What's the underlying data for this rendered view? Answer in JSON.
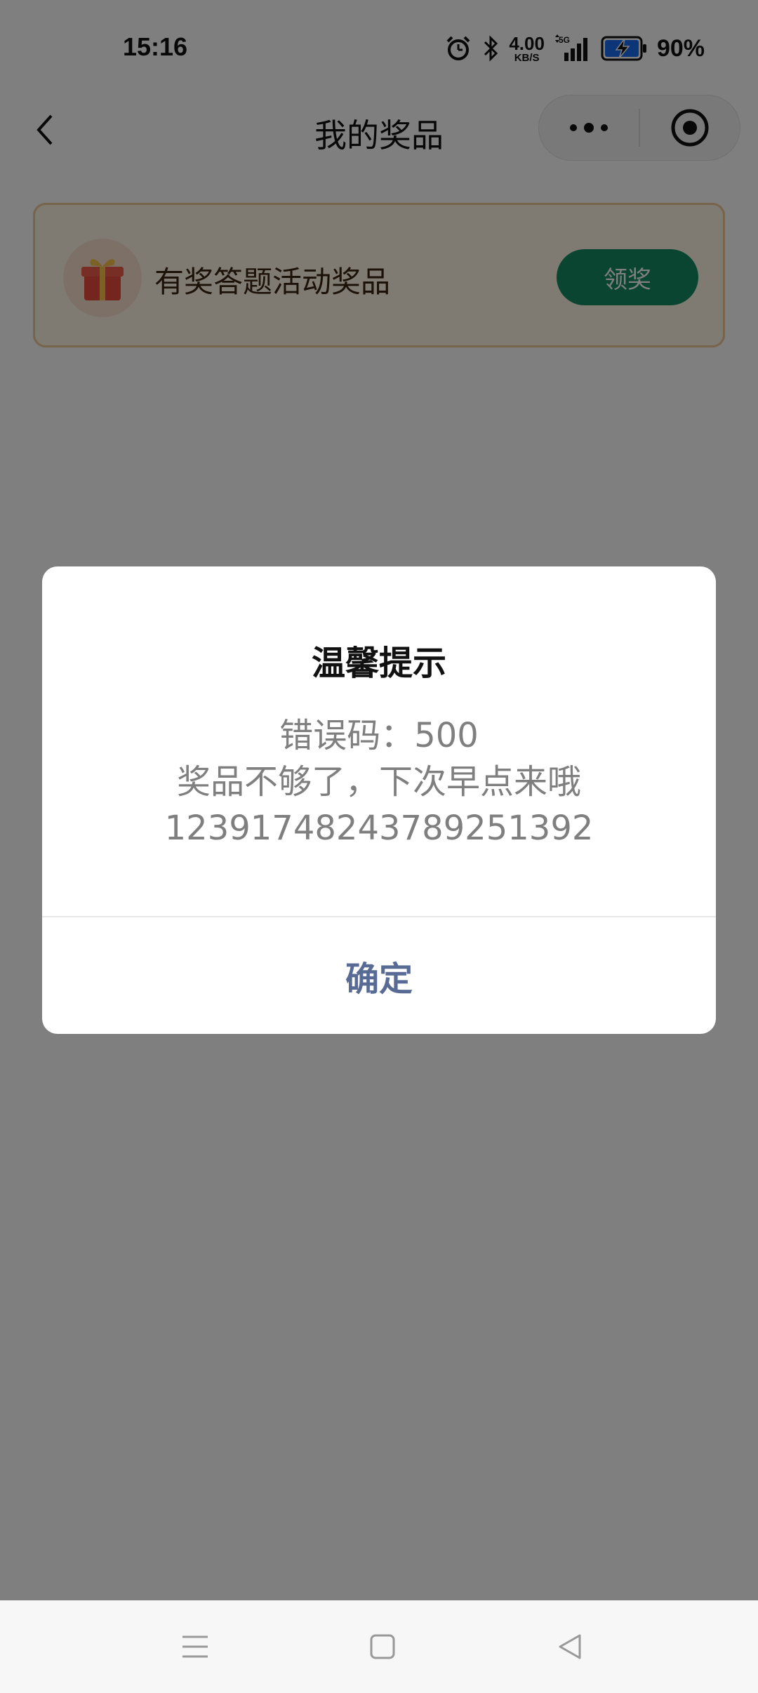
{
  "status_bar": {
    "time": "15:16",
    "net_speed_value": "4.00",
    "net_speed_unit": "KB/S",
    "network": "5G",
    "battery": "90%"
  },
  "nav": {
    "title": "我的奖品"
  },
  "prize": {
    "title": "有奖答题活动奖品",
    "claim_label": "领奖"
  },
  "dialog": {
    "title": "温馨提示",
    "line1": "错误码：500",
    "line2": "奖品不够了，下次早点来哦",
    "line3": "12391748243789251392",
    "confirm_label": "确定"
  },
  "colors": {
    "claim_button": "#128a63",
    "confirm_text": "#576b95",
    "card_border": "#ecc896"
  }
}
